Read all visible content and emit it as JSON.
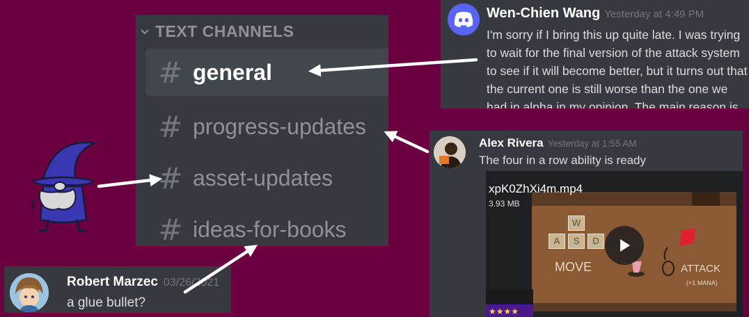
{
  "channels": {
    "category": "TEXT CHANNELS",
    "items": [
      {
        "label": "general",
        "active": true
      },
      {
        "label": "progress-updates",
        "active": false
      },
      {
        "label": "asset-updates",
        "active": false
      },
      {
        "label": "ideas-for-books",
        "active": false
      }
    ]
  },
  "messages": {
    "wen": {
      "author": "Wen-Chien Wang",
      "timestamp": "Yesterday at 4:49 PM",
      "text": "I'm sorry if I bring this up quite late. I was trying to wait for the final version of the attack system to see if it will become better, but it turns out that the current one is still worse than the one we had in alpha in my opinion. The main reason is that the"
    },
    "alex": {
      "author": "Alex Rivera",
      "timestamp": "Yesterday at 1:55 AM",
      "text": "The four in a row ability is ready",
      "attachment": {
        "filename": "xpK0ZhXi4m.mp4",
        "size": "3.93 MB",
        "scene": {
          "keys": [
            "W",
            "A",
            "S",
            "D"
          ],
          "move_label": "MOVE",
          "attack_label": "ATTACK",
          "mana_label": "(+1 MANA)"
        }
      }
    },
    "robert": {
      "author": "Robert Marzec",
      "timestamp": "03/26/2021",
      "text": "a glue bullet?"
    }
  },
  "icons": {
    "hash": "#",
    "discord": "discord-logo-icon",
    "play": "play-icon",
    "chevron": "chevron-down-icon"
  },
  "colors": {
    "background": "#6a0040",
    "panel": "#36393f",
    "discord_blurple": "#5865f2"
  }
}
